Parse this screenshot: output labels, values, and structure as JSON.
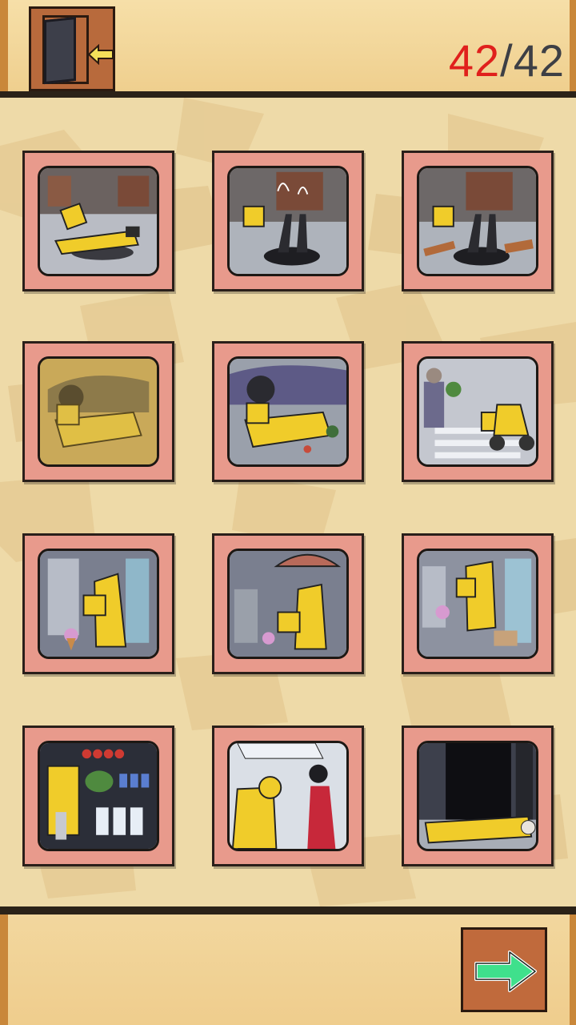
{
  "header": {
    "exit_icon": "exit-door-icon",
    "found": "42",
    "separator": "/",
    "total": "42"
  },
  "colors": {
    "found_counter": "#e0201c",
    "total_counter": "#3d3f45",
    "panel_frame": "#e89a8c",
    "raincoat_yellow": "#f0cc2a",
    "next_arrow": "#3fe08c"
  },
  "panels": [
    {
      "id": 1,
      "scene": "fallen-courier"
    },
    {
      "id": 2,
      "scene": "manhole-legs"
    },
    {
      "id": 3,
      "scene": "manhole-legs-planks"
    },
    {
      "id": 4,
      "scene": "car-crash-sepia"
    },
    {
      "id": 5,
      "scene": "car-crash"
    },
    {
      "id": 6,
      "scene": "scooter-crossing"
    },
    {
      "id": 7,
      "scene": "ice-cream-walk"
    },
    {
      "id": 8,
      "scene": "umbrella-ice-cream"
    },
    {
      "id": 9,
      "scene": "slip-umbrella"
    },
    {
      "id": 10,
      "scene": "shop-shelves"
    },
    {
      "id": 11,
      "scene": "woman-in-red"
    },
    {
      "id": 12,
      "scene": "lying-in-doorway"
    }
  ],
  "footer": {
    "next_icon": "next-arrow-icon"
  }
}
